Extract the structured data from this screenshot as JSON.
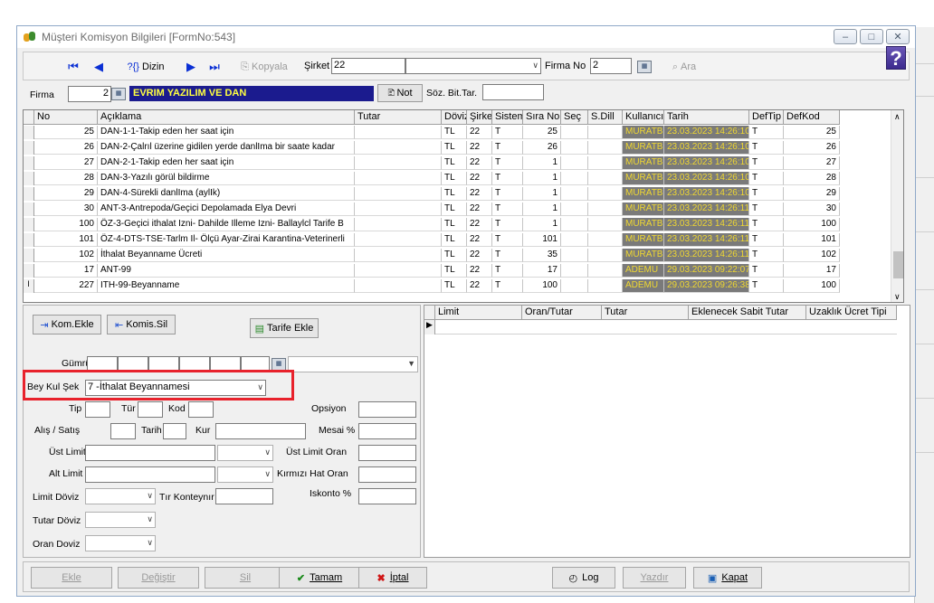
{
  "window": {
    "title": "Müşteri Komisyon Bilgileri [FormNo:543]"
  },
  "toolbar": {
    "dizin_label": "Dizin",
    "kopyala_label": "Kopyala",
    "sirket_label": "Şirket",
    "sirket_value": "22",
    "sirket_name": "",
    "firma_no_label": "Firma No",
    "firma_no_value": "2",
    "ara_label": "Ara"
  },
  "firma": {
    "label": "Firma",
    "code": "2",
    "name": "EVRIM YAZILIM VE DAN",
    "not_label": "Not",
    "soz_label": "Söz. Bit.Tar.",
    "soz_value": ""
  },
  "grid": {
    "headers": [
      "No",
      "Açıklama",
      "Tutar",
      "Döviz",
      "Şirket",
      "Sistem",
      "Sıra No",
      "Seç",
      "S.Dill",
      "Kullanıcı",
      "Tarih",
      "DefTip",
      "DefKod"
    ],
    "rows": [
      {
        "no": "25",
        "aciklama": "DAN-1-1-Takip eden her saat için",
        "tutar": "",
        "doviz": "TL",
        "sirket": "22",
        "sistem": "T",
        "sira": "25",
        "sec": "",
        "sdil": "",
        "user": "MURATB",
        "tarih": "23.03.2023 14:26:10",
        "deftip": "T",
        "defkod": "25"
      },
      {
        "no": "26",
        "aciklama": "DAN-2-Çalrıl üzerine gidilen yerde danlIma bir saate kadar",
        "tutar": "",
        "doviz": "TL",
        "sirket": "22",
        "sistem": "T",
        "sira": "26",
        "sec": "",
        "sdil": "",
        "user": "MURATB",
        "tarih": "23.03.2023 14:26:10",
        "deftip": "T",
        "defkod": "26"
      },
      {
        "no": "27",
        "aciklama": "DAN-2-1-Takip eden her saat için",
        "tutar": "",
        "doviz": "TL",
        "sirket": "22",
        "sistem": "T",
        "sira": "1",
        "sec": "",
        "sdil": "",
        "user": "MURATB",
        "tarih": "23.03.2023 14:26:10",
        "deftip": "T",
        "defkod": "27"
      },
      {
        "no": "28",
        "aciklama": "DAN-3-Yazılı görül bildirme",
        "tutar": "",
        "doviz": "TL",
        "sirket": "22",
        "sistem": "T",
        "sira": "1",
        "sec": "",
        "sdil": "",
        "user": "MURATB",
        "tarih": "23.03.2023 14:26:10",
        "deftip": "T",
        "defkod": "28"
      },
      {
        "no": "29",
        "aciklama": "DAN-4-Sürekli danlIma (aylIk)",
        "tutar": "",
        "doviz": "TL",
        "sirket": "22",
        "sistem": "T",
        "sira": "1",
        "sec": "",
        "sdil": "",
        "user": "MURATB",
        "tarih": "23.03.2023 14:26:10",
        "deftip": "T",
        "defkod": "29"
      },
      {
        "no": "30",
        "aciklama": "ANT-3-Antrepoda/Geçici Depolamada Elya Devri",
        "tutar": "",
        "doviz": "TL",
        "sirket": "22",
        "sistem": "T",
        "sira": "1",
        "sec": "",
        "sdil": "",
        "user": "MURATB",
        "tarih": "23.03.2023 14:26:11",
        "deftip": "T",
        "defkod": "30"
      },
      {
        "no": "100",
        "aciklama": "ÖZ-3-Geçici ithalat Izni- Dahilde Illeme Izni- Ballaylcl Tarife B",
        "tutar": "",
        "doviz": "TL",
        "sirket": "22",
        "sistem": "T",
        "sira": "1",
        "sec": "",
        "sdil": "",
        "user": "MURATB",
        "tarih": "23.03.2023 14:26:11",
        "deftip": "T",
        "defkod": "100"
      },
      {
        "no": "101",
        "aciklama": "ÖZ-4-DTS-TSE-Tarlm Il- Ölçü Ayar-Zirai Karantina-Veterinerli",
        "tutar": "",
        "doviz": "TL",
        "sirket": "22",
        "sistem": "T",
        "sira": "101",
        "sec": "",
        "sdil": "",
        "user": "MURATB",
        "tarih": "23.03.2023 14:26:11",
        "deftip": "T",
        "defkod": "101"
      },
      {
        "no": "102",
        "aciklama": "İthalat Beyanname Ücreti",
        "tutar": "",
        "doviz": "TL",
        "sirket": "22",
        "sistem": "T",
        "sira": "35",
        "sec": "",
        "sdil": "",
        "user": "MURATB",
        "tarih": "23.03.2023 14:26:11",
        "deftip": "T",
        "defkod": "102"
      },
      {
        "no": "17",
        "aciklama": "ANT-99",
        "tutar": "",
        "doviz": "TL",
        "sirket": "22",
        "sistem": "T",
        "sira": "17",
        "sec": "",
        "sdil": "",
        "user": "ADEMU",
        "tarih": "29.03.2023 09:22:07",
        "deftip": "T",
        "defkod": "17"
      },
      {
        "no": "227",
        "aciklama": "ITH-99-Beyanname",
        "tutar": "",
        "doviz": "TL",
        "sirket": "22",
        "sistem": "T",
        "sira": "100",
        "sec": "",
        "sdil": "",
        "user": "ADEMU",
        "tarih": "29.03.2023 09:26:38",
        "deftip": "T",
        "defkod": "100"
      }
    ]
  },
  "left": {
    "kom_ekle": "Kom.Ekle",
    "komis_sil": "Komis.Sil",
    "tarife_ekle": "Tarife Ekle",
    "gumruk_label": "Gümrük",
    "bey_kul_label": "Bey Kul Şek",
    "bey_kul_value": "7 -İthalat Beyannamesi",
    "tip_label": "Tip",
    "tur_label": "Tür",
    "kod_label": "Kod",
    "opsiyon_label": "Opsiyon",
    "alis_label": "Alış / Satış",
    "tarih_label": "Tarih",
    "kur_label": "Kur",
    "mesai_label": "Mesai %",
    "ust_limit_label": "Üst Limit",
    "ust_limit_oran_label": "Üst Limit Oran",
    "alt_limit_label": "Alt Limit",
    "kirmizi_label": "Kırmızı Hat Oran",
    "limit_doviz_label": "Limit Döviz",
    "tir_label": "Tır Konteynır",
    "iskonto_label": "Iskonto %",
    "tutar_doviz_label": "Tutar Döviz",
    "oran_doviz_label": "Oran Doviz"
  },
  "right": {
    "headers": [
      "Limit",
      "Oran/Tutar",
      "Tutar",
      "Eklenecek Sabit Tutar",
      "Uzaklık Ücret Tipi"
    ]
  },
  "bottom": {
    "ekle": "Ekle",
    "degistir": "Değiştir",
    "sil": "Sil",
    "tamam": "Tamam",
    "iptal": "İptal",
    "log": "Log",
    "yazdir": "Yazdır",
    "kapat": "Kapat"
  },
  "colors": {
    "highlight": "#e8222c",
    "firma_bg": "#1b1b8e",
    "firma_fg": "#ffff40",
    "user_cell_bg": "#7a7a7a",
    "user_cell_fg": "#f0d830"
  }
}
